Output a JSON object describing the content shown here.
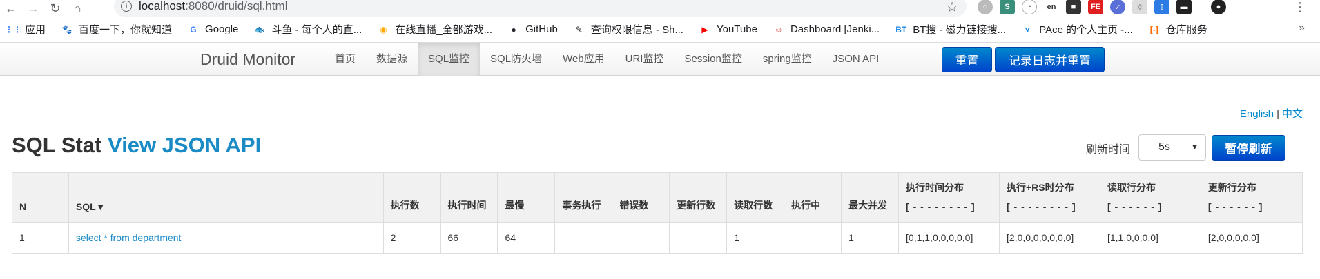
{
  "browser": {
    "url_host": "localhost",
    "url_rest": ":8080/druid/sql.html",
    "bookmarks": [
      {
        "label": "应用",
        "icon": "apps-icon",
        "color": "#4285f4",
        "glyph": "⋮⋮"
      },
      {
        "label": "百度一下，你就知道",
        "icon": "baidu-icon",
        "color": "#2932e1",
        "glyph": "🐾"
      },
      {
        "label": "Google",
        "icon": "google-icon",
        "color": "#4285f4",
        "glyph": "G"
      },
      {
        "label": "斗鱼 - 每个人的直...",
        "icon": "douyu-icon",
        "color": "#ff7700",
        "glyph": "🐟"
      },
      {
        "label": "在线直播_全部游戏...",
        "icon": "huya-icon",
        "color": "#ffa800",
        "glyph": "◉"
      },
      {
        "label": "GitHub",
        "icon": "github-icon",
        "color": "#24292e",
        "glyph": "●"
      },
      {
        "label": "查询权限信息 - Sh...",
        "icon": "shiro-icon",
        "color": "#111111",
        "glyph": "✎"
      },
      {
        "label": "YouTube",
        "icon": "youtube-icon",
        "color": "#ff0000",
        "glyph": "▶"
      },
      {
        "label": "Dashboard [Jenki...",
        "icon": "jenkins-icon",
        "color": "#d33833",
        "glyph": "☺"
      },
      {
        "label": "BT搜 - 磁力链接搜...",
        "icon": "bt-icon",
        "color": "#1e88e5",
        "glyph": "BT"
      },
      {
        "label": "PAce 的个人主页 -...",
        "icon": "pace-icon",
        "color": "#1e88e5",
        "glyph": "⋎"
      },
      {
        "label": "仓库服务",
        "icon": "repo-icon",
        "color": "#ff6a00",
        "glyph": "[-]"
      }
    ]
  },
  "navbar": {
    "brand": "Druid Monitor",
    "items": [
      "首页",
      "数据源",
      "SQL监控",
      "SQL防火墙",
      "Web应用",
      "URI监控",
      "Session监控",
      "spring监控",
      "JSON API"
    ],
    "active_index": 2,
    "reset_label": "重置",
    "log_reset_label": "记录日志并重置"
  },
  "lang": {
    "english": "English",
    "sep": "|",
    "chinese": "中文"
  },
  "page": {
    "title": "SQL Stat",
    "title_link": "View JSON API",
    "refresh_label": "刷新时间",
    "refresh_value": "5s",
    "pause_label": "暂停刷新"
  },
  "table": {
    "headers": [
      {
        "label": "N"
      },
      {
        "label": "SQL▼"
      },
      {
        "label": "执行数"
      },
      {
        "label": "执行时间"
      },
      {
        "label": "最慢"
      },
      {
        "label": "事务执行"
      },
      {
        "label": "错误数"
      },
      {
        "label": "更新行数"
      },
      {
        "label": "读取行数"
      },
      {
        "label": "执行中"
      },
      {
        "label": "最大并发"
      },
      {
        "label": "执行时间分布",
        "sub": "[ - - - - - - - - ]"
      },
      {
        "label": "执行+RS时分布",
        "sub": "[ - - - - - - - - ]"
      },
      {
        "label": "读取行分布",
        "sub": "[ - - - - - - ]"
      },
      {
        "label": "更新行分布",
        "sub": "[ - - - - - - ]"
      }
    ],
    "rows": [
      [
        "1",
        "select * from department",
        "2",
        "66",
        "64",
        "",
        "",
        "",
        "1",
        "",
        "1",
        "[0,1,1,0,0,0,0,0]",
        "[2,0,0,0,0,0,0,0]",
        "[1,1,0,0,0,0]",
        "[2,0,0,0,0,0]"
      ]
    ]
  },
  "colors": {
    "link": "#1a8bc5",
    "primary": "#0055cc"
  }
}
